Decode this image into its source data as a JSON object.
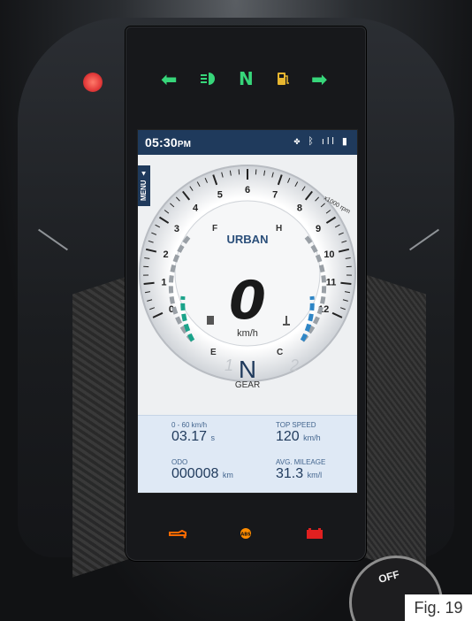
{
  "telltales_top": [
    {
      "name": "abs-warning-icon",
      "color": "#e33a3a"
    },
    {
      "name": "left-indicator-icon",
      "color": "#37d67a"
    },
    {
      "name": "high-beam-icon",
      "color": "#37d67a"
    },
    {
      "name": "neutral-indicator",
      "label": "N",
      "color": "#37d67a"
    },
    {
      "name": "low-fuel-icon",
      "color": "#e8b630"
    },
    {
      "name": "right-indicator-icon",
      "color": "#37d67a"
    }
  ],
  "status_bar": {
    "time": "05:30",
    "ampm": "PM",
    "icons": "✤ ᛒ ıll ▮"
  },
  "menu": {
    "label": "MENU ▲"
  },
  "gauge": {
    "ride_mode": "URBAN",
    "speed": "0",
    "speed_unit": "km/h",
    "rpm_unit": "x1000 rpm",
    "rpm_ticks": [
      "0",
      "1",
      "2",
      "3",
      "4",
      "5",
      "6",
      "7",
      "8",
      "9",
      "10",
      "11",
      "12"
    ],
    "fuel_full": "F",
    "fuel_empty": "E",
    "temp_hot": "H",
    "temp_cold": "C"
  },
  "gear": {
    "value": "N",
    "label": "GEAR",
    "prev": "1",
    "next": "2"
  },
  "stats": {
    "zero_sixty": {
      "label": "0 - 60 km/h",
      "value": "03.17",
      "unit": "s"
    },
    "top_speed": {
      "label": "TOP SPEED",
      "value": "120",
      "unit": "km/h"
    },
    "odo": {
      "label": "ODO",
      "value": "000008",
      "unit": "km"
    },
    "avg_mileage": {
      "label": "AVG. MILEAGE",
      "value": "31.3",
      "unit": "km/l"
    }
  },
  "telltales_bottom": [
    {
      "name": "engine-oil-icon",
      "color": "#ff6a00"
    },
    {
      "name": "abs-amber-icon",
      "color": "#ff8c00"
    },
    {
      "name": "battery-icon",
      "color": "#e02020"
    }
  ],
  "ignition": {
    "off": "OFF"
  },
  "figure_label": "Fig. 19"
}
